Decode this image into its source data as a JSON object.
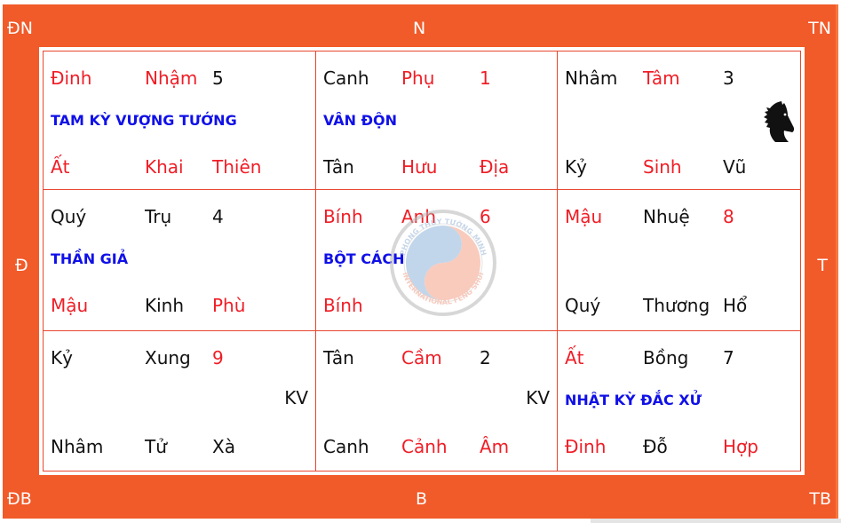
{
  "directions": {
    "northeast_top_left": "ĐN",
    "north": "N",
    "northwest_top_right": "TN",
    "east_left": "Đ",
    "west_right": "T",
    "southeast_bottom_left": "ĐB",
    "south": "B",
    "southwest_bottom_right": "TB"
  },
  "palaces": [
    {
      "row1": [
        {
          "text": "Đinh",
          "color": "red"
        },
        {
          "text": "Nhậm",
          "color": "red"
        },
        {
          "text": "5",
          "color": "black"
        }
      ],
      "label": "TAM KỲ VƯỢNG TƯỚNG",
      "row3": [
        {
          "text": "Ất",
          "color": "red"
        },
        {
          "text": "Khai",
          "color": "red"
        },
        {
          "text": "Thiên",
          "color": "red"
        }
      ]
    },
    {
      "row1": [
        {
          "text": "Canh",
          "color": "black"
        },
        {
          "text": "Phụ",
          "color": "red"
        },
        {
          "text": "1",
          "color": "red"
        }
      ],
      "label": "VÂN ĐỘN",
      "row3": [
        {
          "text": "Tân",
          "color": "black"
        },
        {
          "text": "Hưu",
          "color": "red"
        },
        {
          "text": "Địa",
          "color": "red"
        }
      ]
    },
    {
      "row1": [
        {
          "text": "Nhâm",
          "color": "black"
        },
        {
          "text": "Tâm",
          "color": "red"
        },
        {
          "text": "3",
          "color": "black"
        }
      ],
      "label": "",
      "icon": "horse-icon",
      "row3": [
        {
          "text": "Kỷ",
          "color": "black"
        },
        {
          "text": "Sinh",
          "color": "red"
        },
        {
          "text": "Vũ",
          "color": "black"
        }
      ]
    },
    {
      "row1": [
        {
          "text": "Quý",
          "color": "black"
        },
        {
          "text": "Trụ",
          "color": "black"
        },
        {
          "text": "4",
          "color": "black"
        }
      ],
      "label": "THẦN GIẢ",
      "row3": [
        {
          "text": "Mậu",
          "color": "red"
        },
        {
          "text": "Kinh",
          "color": "black"
        },
        {
          "text": "Phù",
          "color": "red"
        }
      ]
    },
    {
      "row1": [
        {
          "text": "Bính",
          "color": "red"
        },
        {
          "text": "Anh",
          "color": "red"
        },
        {
          "text": "6",
          "color": "red"
        }
      ],
      "label": "BỘT CÁCH",
      "row3": [
        {
          "text": "Bính",
          "color": "red"
        },
        {
          "text": "",
          "color": "black"
        },
        {
          "text": "",
          "color": "black"
        }
      ]
    },
    {
      "row1": [
        {
          "text": "Mậu",
          "color": "red"
        },
        {
          "text": "Nhuệ",
          "color": "black"
        },
        {
          "text": "8",
          "color": "red"
        }
      ],
      "label": "",
      "row3": [
        {
          "text": "Quý",
          "color": "black"
        },
        {
          "text": "Thương",
          "color": "black"
        },
        {
          "text": "Hổ",
          "color": "black"
        }
      ]
    },
    {
      "row1": [
        {
          "text": "Kỷ",
          "color": "black"
        },
        {
          "text": "Xung",
          "color": "black"
        },
        {
          "text": "9",
          "color": "red"
        }
      ],
      "label": "",
      "kv": "KV",
      "row3": [
        {
          "text": "Nhâm",
          "color": "black"
        },
        {
          "text": "Tử",
          "color": "black"
        },
        {
          "text": "Xà",
          "color": "black"
        }
      ]
    },
    {
      "row1": [
        {
          "text": "Tân",
          "color": "black"
        },
        {
          "text": "Cầm",
          "color": "red"
        },
        {
          "text": "2",
          "color": "black"
        }
      ],
      "label": "",
      "kv": "KV",
      "row3": [
        {
          "text": "Canh",
          "color": "black"
        },
        {
          "text": "Cảnh",
          "color": "red"
        },
        {
          "text": "Âm",
          "color": "red"
        }
      ]
    },
    {
      "row1": [
        {
          "text": "Ất",
          "color": "red"
        },
        {
          "text": "Bồng",
          "color": "black"
        },
        {
          "text": "7",
          "color": "black"
        }
      ],
      "label": "NHẬT KỲ ĐẮC XỬ",
      "row3": [
        {
          "text": "Đinh",
          "color": "red"
        },
        {
          "text": "Đỗ",
          "color": "black"
        },
        {
          "text": "Hợp",
          "color": "red"
        }
      ]
    }
  ],
  "watermark": {
    "top_text": "PHONG THỦY TƯỜNG MINH",
    "bottom_text": "INTERNATIONAL FENG SHUI"
  },
  "colors": {
    "frame": "#f15a29",
    "red_text": "#f01d26",
    "blue_label": "#1010e8",
    "black_text": "#111111",
    "grid_line": "#e8462e"
  }
}
